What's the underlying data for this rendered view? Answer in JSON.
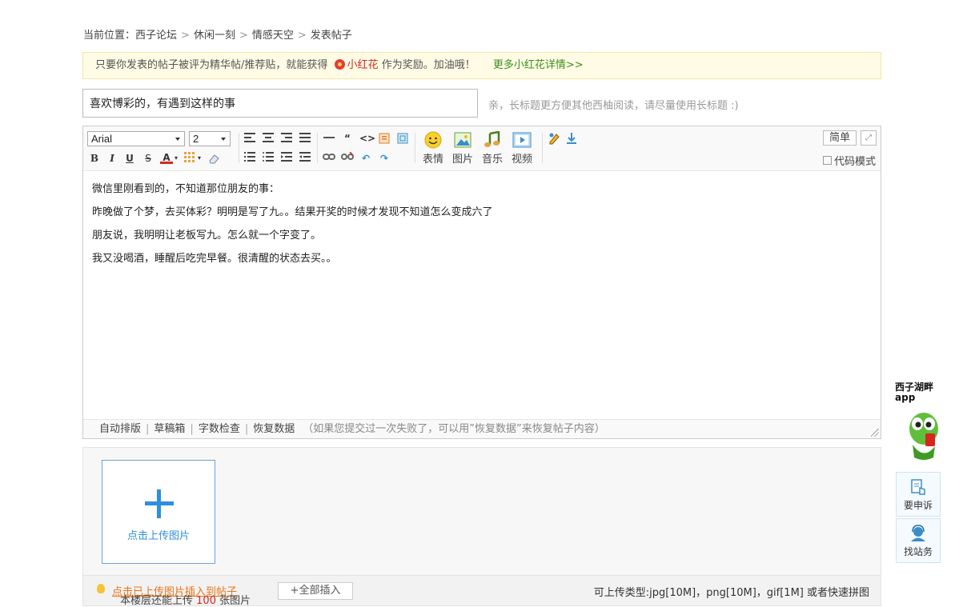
{
  "breadcrumb": {
    "prefix": "当前位置：",
    "items": [
      "西子论坛",
      "休闲一刻",
      "情感天空",
      "发表帖子"
    ]
  },
  "notice": {
    "text_before": "只要你发表的帖子被评为精华帖/推荐贴，就能获得",
    "flower_label": "小红花",
    "text_after": "作为奖励。加油哦！",
    "more_link": "更多小红花详情>>"
  },
  "title": {
    "value": "喜欢博彩的，有遇到这样的事",
    "hint": "亲，长标题更方便其他西柚阅读，请尽量使用长标题 :)"
  },
  "toolbar": {
    "font_family": "Arial",
    "font_size": "2",
    "big_buttons": [
      "表情",
      "图片",
      "音乐",
      "视频"
    ],
    "simple_button": "简单",
    "code_mode": "代码模式"
  },
  "content": {
    "lines": [
      "微信里刚看到的，不知道那位朋友的事：",
      "昨晚做了个梦，去买体彩？明明是写了九。。结果开奖的时候才发现不知道怎么变成六了",
      "朋友说，我明明让老板写九。怎么就一个字变了。",
      "我又没喝酒，睡醒后吃完早餐。很清醒的状态去买。。"
    ]
  },
  "editor_footer": {
    "auto_layout": "自动排版",
    "drafts": "草稿箱",
    "word_check": "字数检查",
    "restore": "恢复数据",
    "restore_tip": "（如果您提交过一次失败了，可以用”恢复数据”来恢复帖子内容）"
  },
  "upload": {
    "box_label": "点击上传图片",
    "insert_link": "点击已上传图片插入到帖子",
    "remain_before": "本楼层还能上传",
    "remain_count": "100",
    "remain_after": "张图片",
    "insert_all": "+全部插入",
    "types": "可上传类型:jpg[10M]，png[10M]，gif[1M] 或者快速拼图"
  },
  "side": {
    "app_label_line1": "西子湖畔",
    "app_label_line2": "app",
    "complain": "要申诉",
    "service": "找站务"
  },
  "colors": {
    "accent_blue": "#2f8ee0",
    "notice_bg": "#fffbe5",
    "red": "#d5271f",
    "green": "#3a8f1e",
    "orange": "#e8761b"
  }
}
